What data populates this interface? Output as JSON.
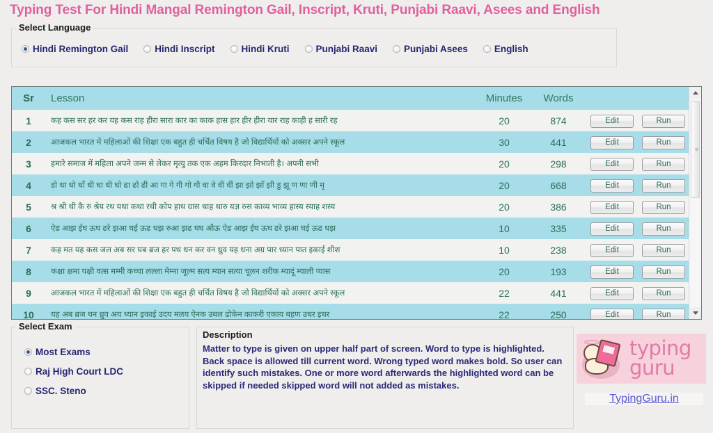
{
  "page": {
    "title": "Typing Test For Hindi Mangal Remington Gail, Inscript, Kruti, Punjabi Raavi, Asees and English"
  },
  "language_group": {
    "legend": "Select Language",
    "options": [
      {
        "label": "Hindi Remington Gail",
        "checked": true
      },
      {
        "label": "Hindi Inscript",
        "checked": false
      },
      {
        "label": "Hindi Kruti",
        "checked": false
      },
      {
        "label": "Punjabi Raavi",
        "checked": false
      },
      {
        "label": "Punjabi Asees",
        "checked": false
      },
      {
        "label": "English",
        "checked": false
      }
    ]
  },
  "lesson_table": {
    "headers": {
      "sr": "Sr",
      "lesson": "Lesson",
      "minutes": "Minutes",
      "words": "Words"
    },
    "edit_label": "Edit",
    "run_label": "Run",
    "rows": [
      {
        "sr": "1",
        "lesson": "कह कस सर हर कर यह कस राह हीरा सारा कार का काक हास हार हीर हीरा यार राह काही ह सारी रह",
        "minutes": "20",
        "words": "874"
      },
      {
        "sr": "2",
        "lesson": "आजकल भारत में महिलाओं की शिक्षा एक बहुत ही चर्चित विषय है जो विद्यार्थियों को अक्सर अपने स्कूल",
        "minutes": "30",
        "words": "441"
      },
      {
        "sr": "3",
        "lesson": "हमारे समाज में महिला अपने जन्म से लेकर मृत्यु तक एक अहम किरदार निभाती है। अपनी सभी",
        "minutes": "20",
        "words": "298"
      },
      {
        "sr": "4",
        "lesson": "डो धा धो धाँ धी घा धी घो ढा ढो ढी आ गा गे गी गो गौ वा वे वी वीं झा झो झाँ झी डु झू ण णा णी मृ",
        "minutes": "20",
        "words": "668"
      },
      {
        "sr": "5",
        "lesson": "श्र श्री थी कै रु श्रेय रथ यथा कथा रथी कोप हाथ ग्रास थाह थारु यज्ञ रुस काव्य भाव्य हास्य स्याह शस्य",
        "minutes": "20",
        "words": "386"
      },
      {
        "sr": "6",
        "lesson": "ऐढ आझ ईघ ऊघ ढरे झआ घई ऊढ धझ रुआ झढ घघ औऊ ऐढ आझ ईघ ऊघ ढरे झआ घई ऊढ धझ",
        "minutes": "10",
        "words": "335"
      },
      {
        "sr": "7",
        "lesson": "कह मत यह कस जल अब सर घब ब्रज हर पथ धन कर वन ध्रुव यह धना अग्र पार ध्यान पात इकाई शीश",
        "minutes": "10",
        "words": "238"
      },
      {
        "sr": "8",
        "lesson": "कक्षा क्षमा पक्षी वत्स मम्मी कच्चा लल्ला मेम्ना जूल्म सत्य म्यान सत्या चूलन शरीक म्यादूं म्याली प्यास",
        "minutes": "20",
        "words": "193"
      },
      {
        "sr": "9",
        "lesson": "आजकल भारत में महिलाओं की शिक्षा एक बहुत ही चर्चित विषय है जो विद्यार्थियों को अक्सर अपने स्कूल",
        "minutes": "22",
        "words": "441"
      },
      {
        "sr": "10",
        "lesson": "यह अब ब्रज धन ध्रुव अय ध्यान इकाई उदय मलय ऐनक उबल ढोकेन काकरी एकाय बहण उधर इधर",
        "minutes": "22",
        "words": "250"
      }
    ],
    "scrollbar": {
      "up_arrow": "scroll-up",
      "down_arrow": "scroll-down",
      "grip": "≡"
    }
  },
  "exam_group": {
    "legend": "Select Exam",
    "options": [
      {
        "label": "Most Exams",
        "checked": true
      },
      {
        "label": "Raj High Court LDC",
        "checked": false
      },
      {
        "label": "SSC. Steno",
        "checked": false
      }
    ]
  },
  "description": {
    "title": "Description",
    "body": "Matter to type is given on upper half part of screen. Word to type is highlighted. Back space is allowed till current word. Wrong typed word makes bold. So user can identify such mistakes. One or more word afterwards the highlighted word can be skipped if needed skipped word will not added as mistakes."
  },
  "branding": {
    "logo_line1": "typing",
    "logo_line2": "guru",
    "site_link": "TypingGuru.in"
  },
  "colors": {
    "title": "#e15f9e",
    "radio_label": "#252570",
    "table_header_bg": "#a7dce9",
    "row_even_bg": "#a7dce9",
    "row_odd_bg": "#f2f3f1",
    "table_text": "#2b6e58",
    "description_text": "#2a2a78",
    "logo_pink": "#e07ba6",
    "logo_bg": "#f7d2dc",
    "link": "#5a5ad6",
    "page_bg": "#efeeec"
  }
}
